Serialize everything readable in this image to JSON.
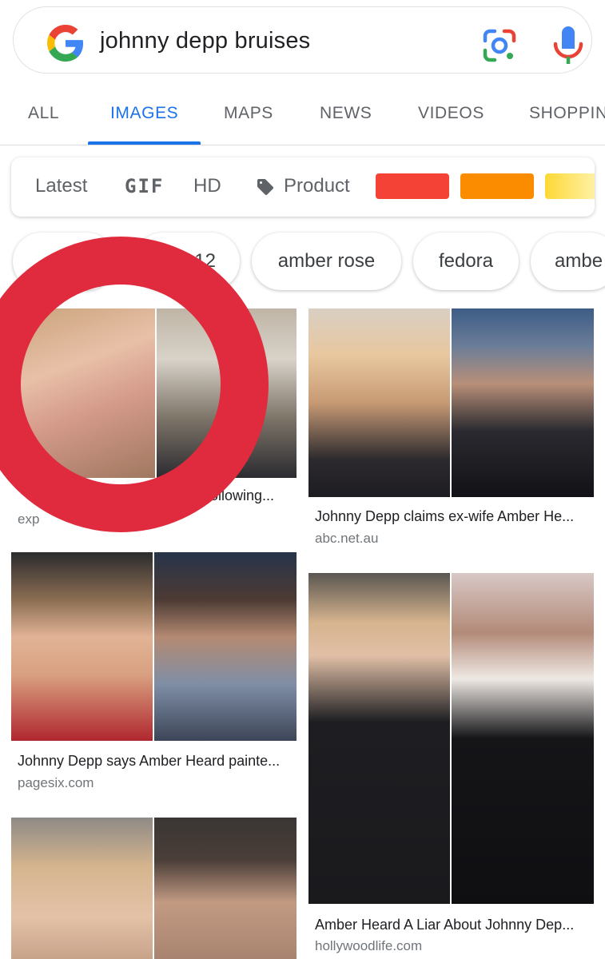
{
  "search": {
    "query": "johnny depp bruises"
  },
  "icons": {
    "logo": "google-g-icon",
    "lens": "google-lens-icon",
    "mic": "microphone-icon",
    "product_tag": "tag-icon"
  },
  "tabs": [
    {
      "label": "ALL"
    },
    {
      "label": "IMAGES"
    },
    {
      "label": "MAPS"
    },
    {
      "label": "NEWS"
    },
    {
      "label": "VIDEOS"
    },
    {
      "label": "SHOPPIN"
    }
  ],
  "filters": {
    "latest": "Latest",
    "gif": "GIF",
    "hd": "HD",
    "product": "Product",
    "colors": [
      "#f44336",
      "#fb8c00",
      "#fdd835"
    ]
  },
  "chips": [
    {
      "label": ""
    },
    {
      "label": "12"
    },
    {
      "label": "amber rose"
    },
    {
      "label": "fedora"
    },
    {
      "label": "ambe"
    }
  ],
  "results": [
    {
      "caption": "s following...",
      "source": "exp"
    },
    {
      "caption": "Johnny Depp claims ex-wife Amber He...",
      "source": "abc.net.au"
    },
    {
      "caption": "Johnny Depp says Amber Heard painte...",
      "source": "pagesix.com"
    },
    {
      "caption": "Amber Heard A Liar About Johnny Dep...",
      "source": "hollywoodlife.com"
    },
    {
      "caption": "",
      "source": ""
    }
  ],
  "annotation": {
    "ring_color": "#e02a3d"
  }
}
